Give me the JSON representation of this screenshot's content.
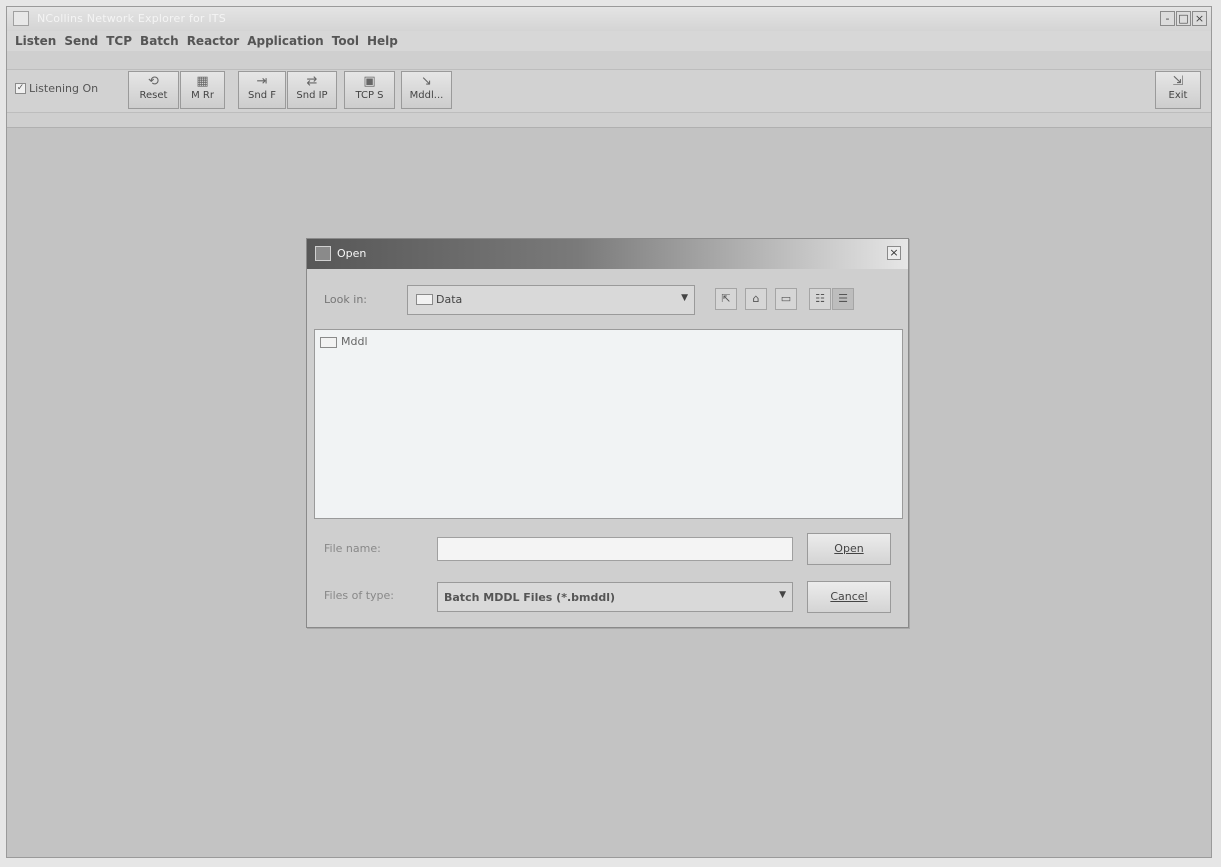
{
  "app": {
    "title": "NCollins Network Explorer for ITS",
    "window_controls": [
      "-",
      "□",
      "×"
    ]
  },
  "menu": [
    "Listen",
    "Send",
    "TCP",
    "Batch",
    "Reactor",
    "Application",
    "Tool",
    "Help"
  ],
  "toolbar": {
    "listening_label": "Listening On",
    "listening_checked": true,
    "buttons": [
      {
        "label": "Reset",
        "icon": "reset-icon"
      },
      {
        "label": "M Rr",
        "icon": "grid-icon"
      },
      {
        "label": "Snd F",
        "icon": "send-file-icon"
      },
      {
        "label": "Snd IP",
        "icon": "send-ip-icon"
      },
      {
        "label": "TCP S",
        "icon": "tcp-icon"
      },
      {
        "label": "Mddl...",
        "icon": "module-icon"
      }
    ],
    "exit_label": "Exit"
  },
  "dialog": {
    "title": "Open",
    "look_in_label": "Look in:",
    "look_in_value": "Data",
    "files": [
      {
        "name": "Mddl",
        "type": "folder"
      }
    ],
    "file_name_label": "File name:",
    "file_name_value": "",
    "files_of_type_label": "Files of type:",
    "files_of_type_value": "Batch MDDL Files (*.bmddl)",
    "open_label": "Open",
    "cancel_label": "Cancel"
  }
}
